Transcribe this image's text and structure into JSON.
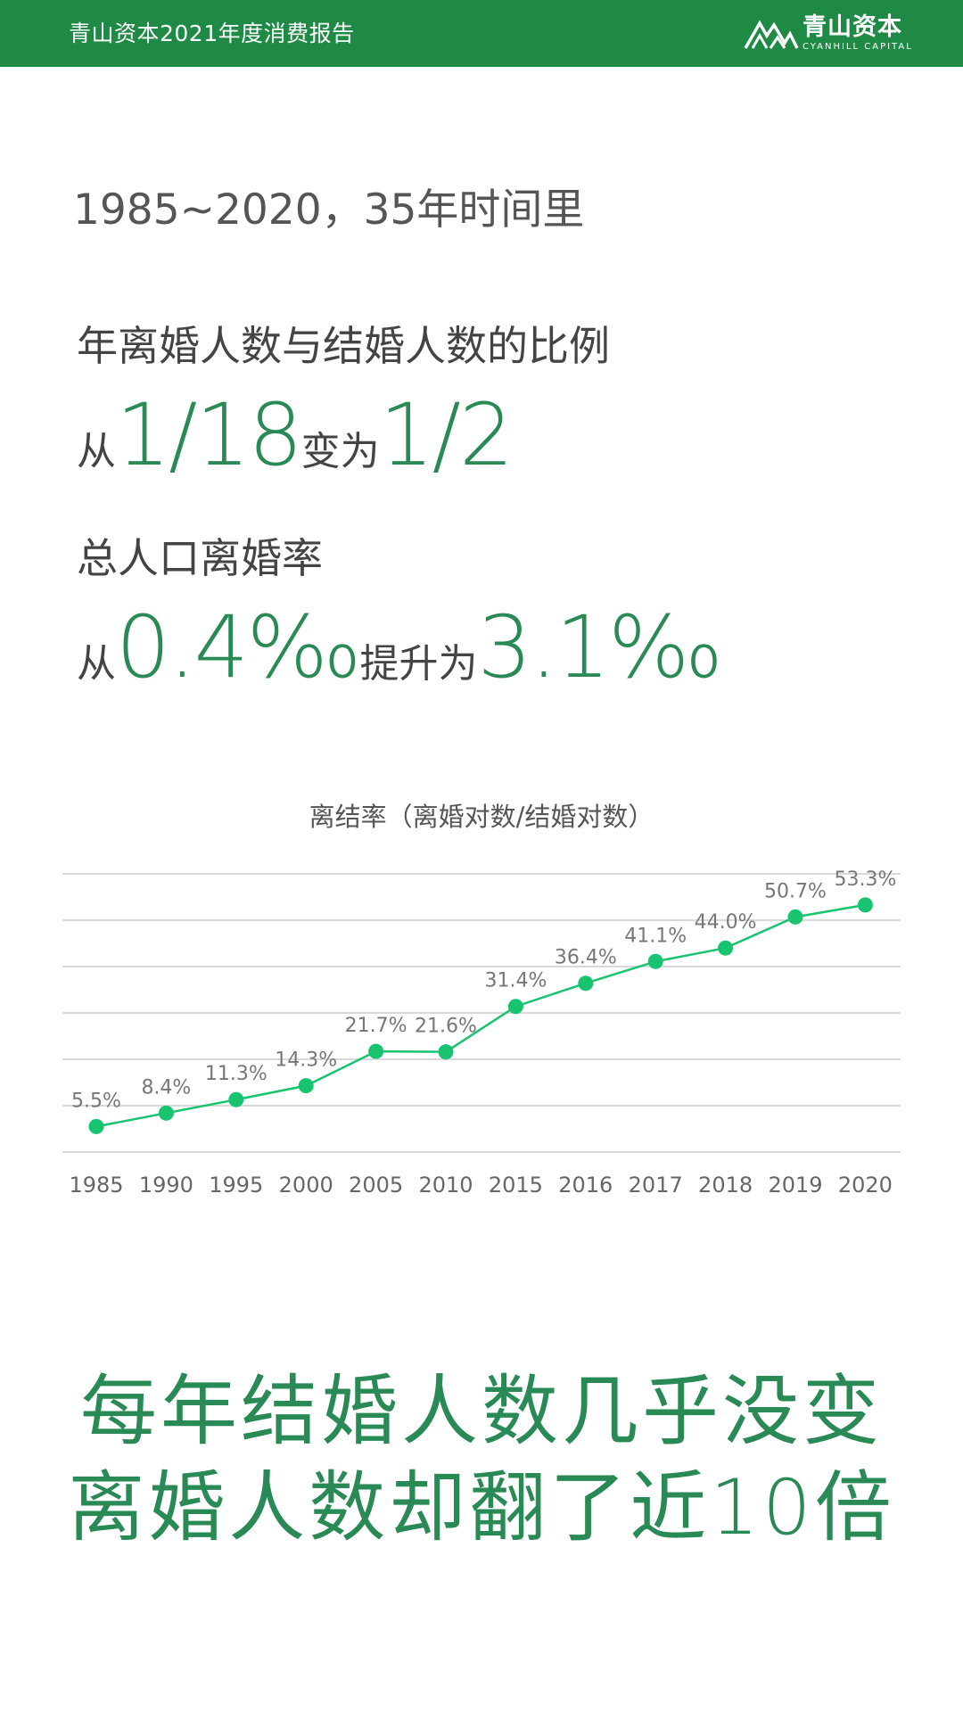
{
  "header": {
    "report_title": "青山资本2021年度消费报告",
    "logo_cn": "青山资本",
    "logo_en": "CYANHILL CAPITAL"
  },
  "intro": "1985~2020，35年时间里",
  "stat1": {
    "label": "年离婚人数与结婚人数的比例",
    "prefix": "从",
    "from": "1/18",
    "middle": "变为",
    "to": "1/2"
  },
  "stat2": {
    "label": "总人口离婚率",
    "prefix": "从",
    "from": "0.4‰",
    "middle": "提升为",
    "to": "3.1‰"
  },
  "chart_data": {
    "type": "line",
    "title": "离结率（离婚对数/结婚对数）",
    "categories": [
      "1985",
      "1990",
      "1995",
      "2000",
      "2005",
      "2010",
      "2015",
      "2016",
      "2017",
      "2018",
      "2019",
      "2020"
    ],
    "values": [
      5.5,
      8.4,
      11.3,
      14.3,
      21.7,
      21.6,
      31.4,
      36.4,
      41.1,
      44.0,
      50.7,
      53.3
    ],
    "data_labels": [
      "5.5%",
      "8.4%",
      "11.3%",
      "14.3%",
      "21.7%",
      "21.6%",
      "31.4%",
      "36.4%",
      "41.1%",
      "44.0%",
      "50.7%",
      "53.3%"
    ],
    "ylim": [
      0,
      60
    ],
    "grid": true,
    "y_tick_labels_shown": false,
    "colors": {
      "line": "#18c46f",
      "grid": "#d9d9d9",
      "label": "#777777"
    }
  },
  "conclusion": {
    "line1": "每年结婚人数几乎没变",
    "line2": "离婚人数却翻了近10倍"
  },
  "colors": {
    "brand_green": "#1f8a45",
    "accent_green": "#2a8a55"
  }
}
